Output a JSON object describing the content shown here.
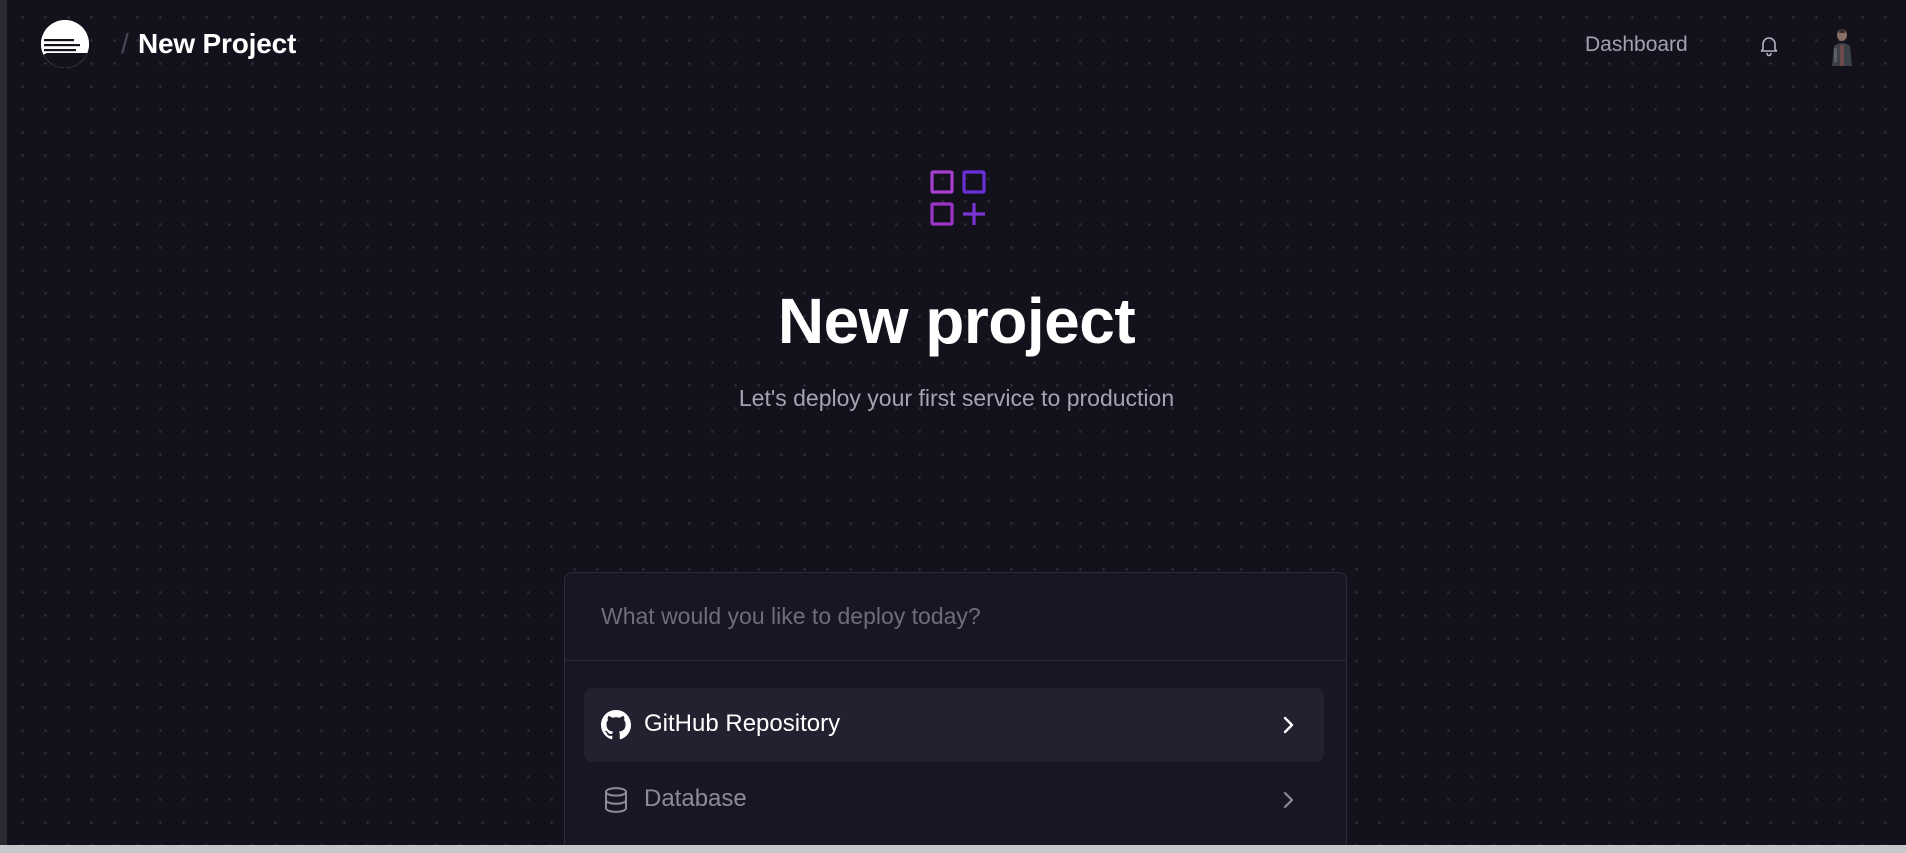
{
  "header": {
    "logo_icon": "railway-logo-icon",
    "breadcrumb_separator": "/",
    "title": "New Project",
    "nav_dashboard": "Dashboard",
    "bell_icon": "bell-icon",
    "avatar": "user-avatar"
  },
  "hero": {
    "icon": "apps-add-icon",
    "title": "New project",
    "subtitle": "Let's deploy your first service to production"
  },
  "deploy": {
    "search_placeholder": "What would you like to deploy today?",
    "search_value": "",
    "options": [
      {
        "label": "GitHub Repository",
        "icon": "github-icon",
        "active": true
      },
      {
        "label": "Database",
        "icon": "database-icon",
        "active": false
      }
    ]
  },
  "colors": {
    "background": "#13111c",
    "accent_purple": "#9b3fd1",
    "accent_violet": "#6a2fd8",
    "text_primary": "#ffffff",
    "text_muted": "#a6a3b3"
  }
}
